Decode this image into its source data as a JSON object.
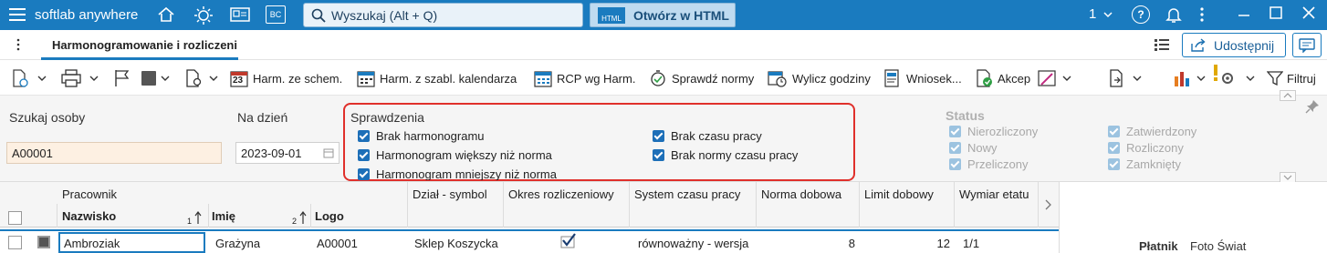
{
  "app": {
    "name": "softlab anywhere",
    "notif_count": "1"
  },
  "search": {
    "placeholder": "Wyszukaj (Alt + Q)"
  },
  "html_btn": {
    "badge": "HTML",
    "label": "Otwórz w HTML"
  },
  "icons": {
    "home": "home-icon",
    "brightness": "brightness-icon",
    "id_card": "id-card-icon",
    "bc": "BC",
    "help": "?"
  },
  "tab": {
    "label": "Harmonogramowanie i rozliczeni"
  },
  "share": {
    "label": "Udostępnij"
  },
  "toolbar": {
    "harm_schem": "Harm. ze schem.",
    "harm_kal": "Harm. z szabl. kalendarza",
    "rcp": "RCP wg Harm.",
    "sprawdz": "Sprawdź normy",
    "wylicz": "Wylicz godziny",
    "wniosek": "Wniosek...",
    "akcep": "Akcep",
    "filtruj": "Filtruj",
    "cal_day": "23"
  },
  "filters": {
    "szukaj_label": "Szukaj osoby",
    "szukaj_value": "A00001",
    "na_dzien_label": "Na dzień",
    "na_dzien_value": "2023-09-01",
    "sprawdzenia": {
      "title": "Sprawdzenia",
      "items": [
        "Brak harmonogramu",
        "Harmonogram większy niż norma",
        "Harmonogram mniejszy niż norma",
        "Brak czasu pracy",
        "Brak normy czasu pracy"
      ]
    },
    "status": {
      "title": "Status",
      "items": [
        "Nierozliczony",
        "Nowy",
        "Przeliczony",
        "Zatwierdzony",
        "Rozliczony",
        "Zamknięty"
      ]
    }
  },
  "grid": {
    "group_header": "Pracownik",
    "headers": {
      "nazwisko": "Nazwisko",
      "imie": "Imię",
      "logo": "Logo",
      "dzial": "Dział - symbol",
      "okres": "Okres rozliczeniowy",
      "system": "System czasu pracy",
      "norma": "Norma dobowa",
      "limit": "Limit dobowy",
      "wymiar": "Wymiar etatu"
    },
    "sort1": "1",
    "sort2": "2",
    "row": {
      "nazwisko": "Ambroziak",
      "imie": "Grażyna",
      "logo": "A00001",
      "dzial": "Sklep Koszycka",
      "system": "równoważny - wersja",
      "norma": "8",
      "limit": "12",
      "wymiar": "1/1"
    },
    "side": {
      "platnik_label": "Płatnik",
      "platnik_value": "Foto Świat"
    }
  }
}
